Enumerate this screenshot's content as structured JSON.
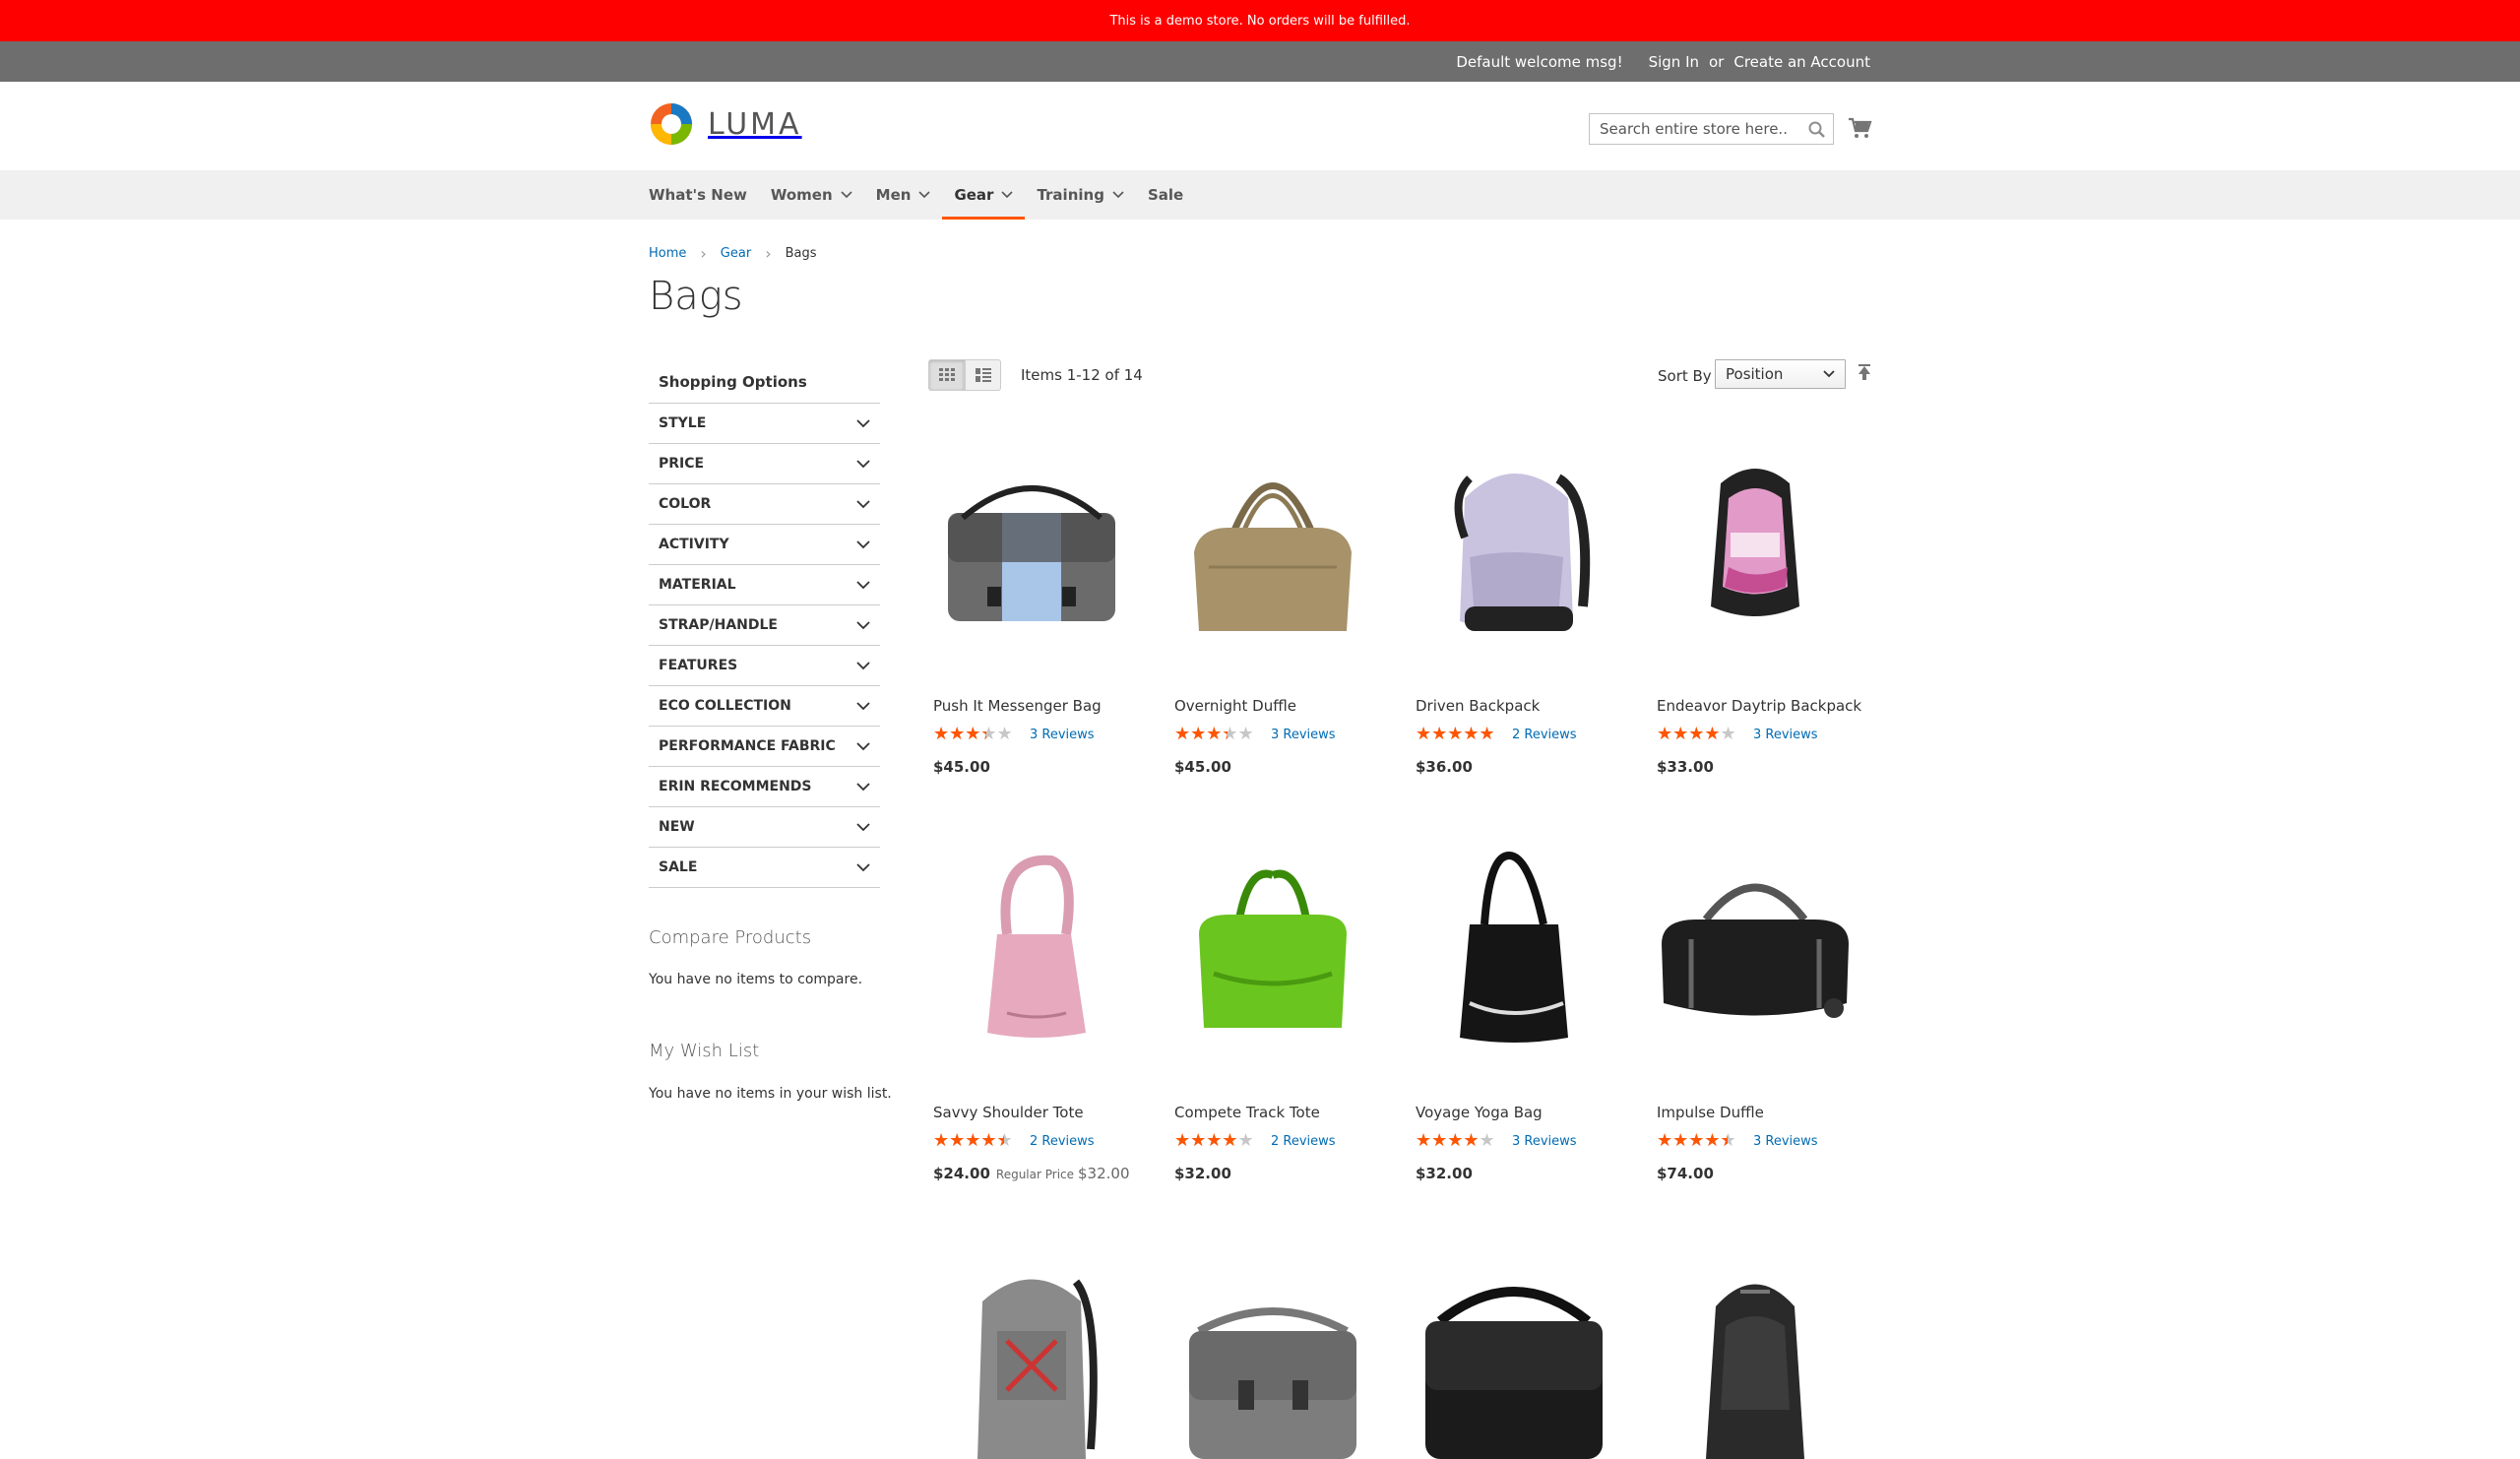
{
  "demo_notice": "This is a demo store. No orders will be fulfilled.",
  "header_links": {
    "welcome": "Default welcome msg!",
    "sign_in": "Sign In",
    "or": "or",
    "create_account": "Create an Account"
  },
  "logo": {
    "text": "LUMA"
  },
  "search": {
    "placeholder": "Search entire store here..."
  },
  "nav": [
    {
      "label": "What's New",
      "dropdown": false
    },
    {
      "label": "Women",
      "dropdown": true
    },
    {
      "label": "Men",
      "dropdown": true
    },
    {
      "label": "Gear",
      "dropdown": true,
      "active": true
    },
    {
      "label": "Training",
      "dropdown": true
    },
    {
      "label": "Sale",
      "dropdown": false
    }
  ],
  "breadcrumbs": {
    "home": "Home",
    "gear": "Gear",
    "current": "Bags"
  },
  "page_title": "Bags",
  "sidebar": {
    "title": "Shopping Options",
    "filters": [
      "STYLE",
      "PRICE",
      "COLOR",
      "ACTIVITY",
      "MATERIAL",
      "STRAP/HANDLE",
      "FEATURES",
      "ECO COLLECTION",
      "PERFORMANCE FABRIC",
      "ERIN RECOMMENDS",
      "NEW",
      "SALE"
    ],
    "compare_title": "Compare Products",
    "compare_empty": "You have no items to compare.",
    "wish_title": "My Wish List",
    "wish_empty": "You have no items in your wish list."
  },
  "toolbar": {
    "amount": "Items 1-12 of 14",
    "sort_label": "Sort By",
    "sort_value": "Position"
  },
  "colors": {
    "accent": "#ff5501",
    "link": "#006bb4",
    "banner": "#ff0000",
    "header_bar": "#6e6e6e"
  },
  "products": [
    {
      "name": "Push It Messenger Bag",
      "rating": 0.6,
      "reviews": "3 Reviews",
      "price": "$45.00",
      "image": "messenger-bag"
    },
    {
      "name": "Overnight Duffle",
      "rating": 0.6,
      "reviews": "3 Reviews",
      "price": "$45.00",
      "image": "duffle-tan"
    },
    {
      "name": "Driven Backpack",
      "rating": 0.9,
      "reviews": "2 Reviews",
      "price": "$36.00",
      "image": "backpack-lavender"
    },
    {
      "name": "Endeavor Daytrip Backpack",
      "rating": 0.7,
      "reviews": "3 Reviews",
      "price": "$33.00",
      "image": "backpack-pink"
    },
    {
      "name": "Savvy Shoulder Tote",
      "rating": 0.8,
      "reviews": "2 Reviews",
      "price": "$24.00",
      "regular_label": "Regular Price",
      "regular_price": "$32.00",
      "image": "tote-pink"
    },
    {
      "name": "Compete Track Tote",
      "rating": 0.7,
      "reviews": "2 Reviews",
      "price": "$32.00",
      "image": "tote-green"
    },
    {
      "name": "Voyage Yoga Bag",
      "rating": 0.7,
      "reviews": "3 Reviews",
      "price": "$32.00",
      "image": "yoga-bag"
    },
    {
      "name": "Impulse Duffle",
      "rating": 0.8,
      "reviews": "3 Reviews",
      "price": "$74.00",
      "image": "duffle-black"
    },
    {
      "name": "",
      "image": "backpack-gray-red"
    },
    {
      "name": "",
      "image": "messenger-gray"
    },
    {
      "name": "",
      "image": "messenger-black"
    },
    {
      "name": "",
      "image": "backpack-black"
    }
  ]
}
